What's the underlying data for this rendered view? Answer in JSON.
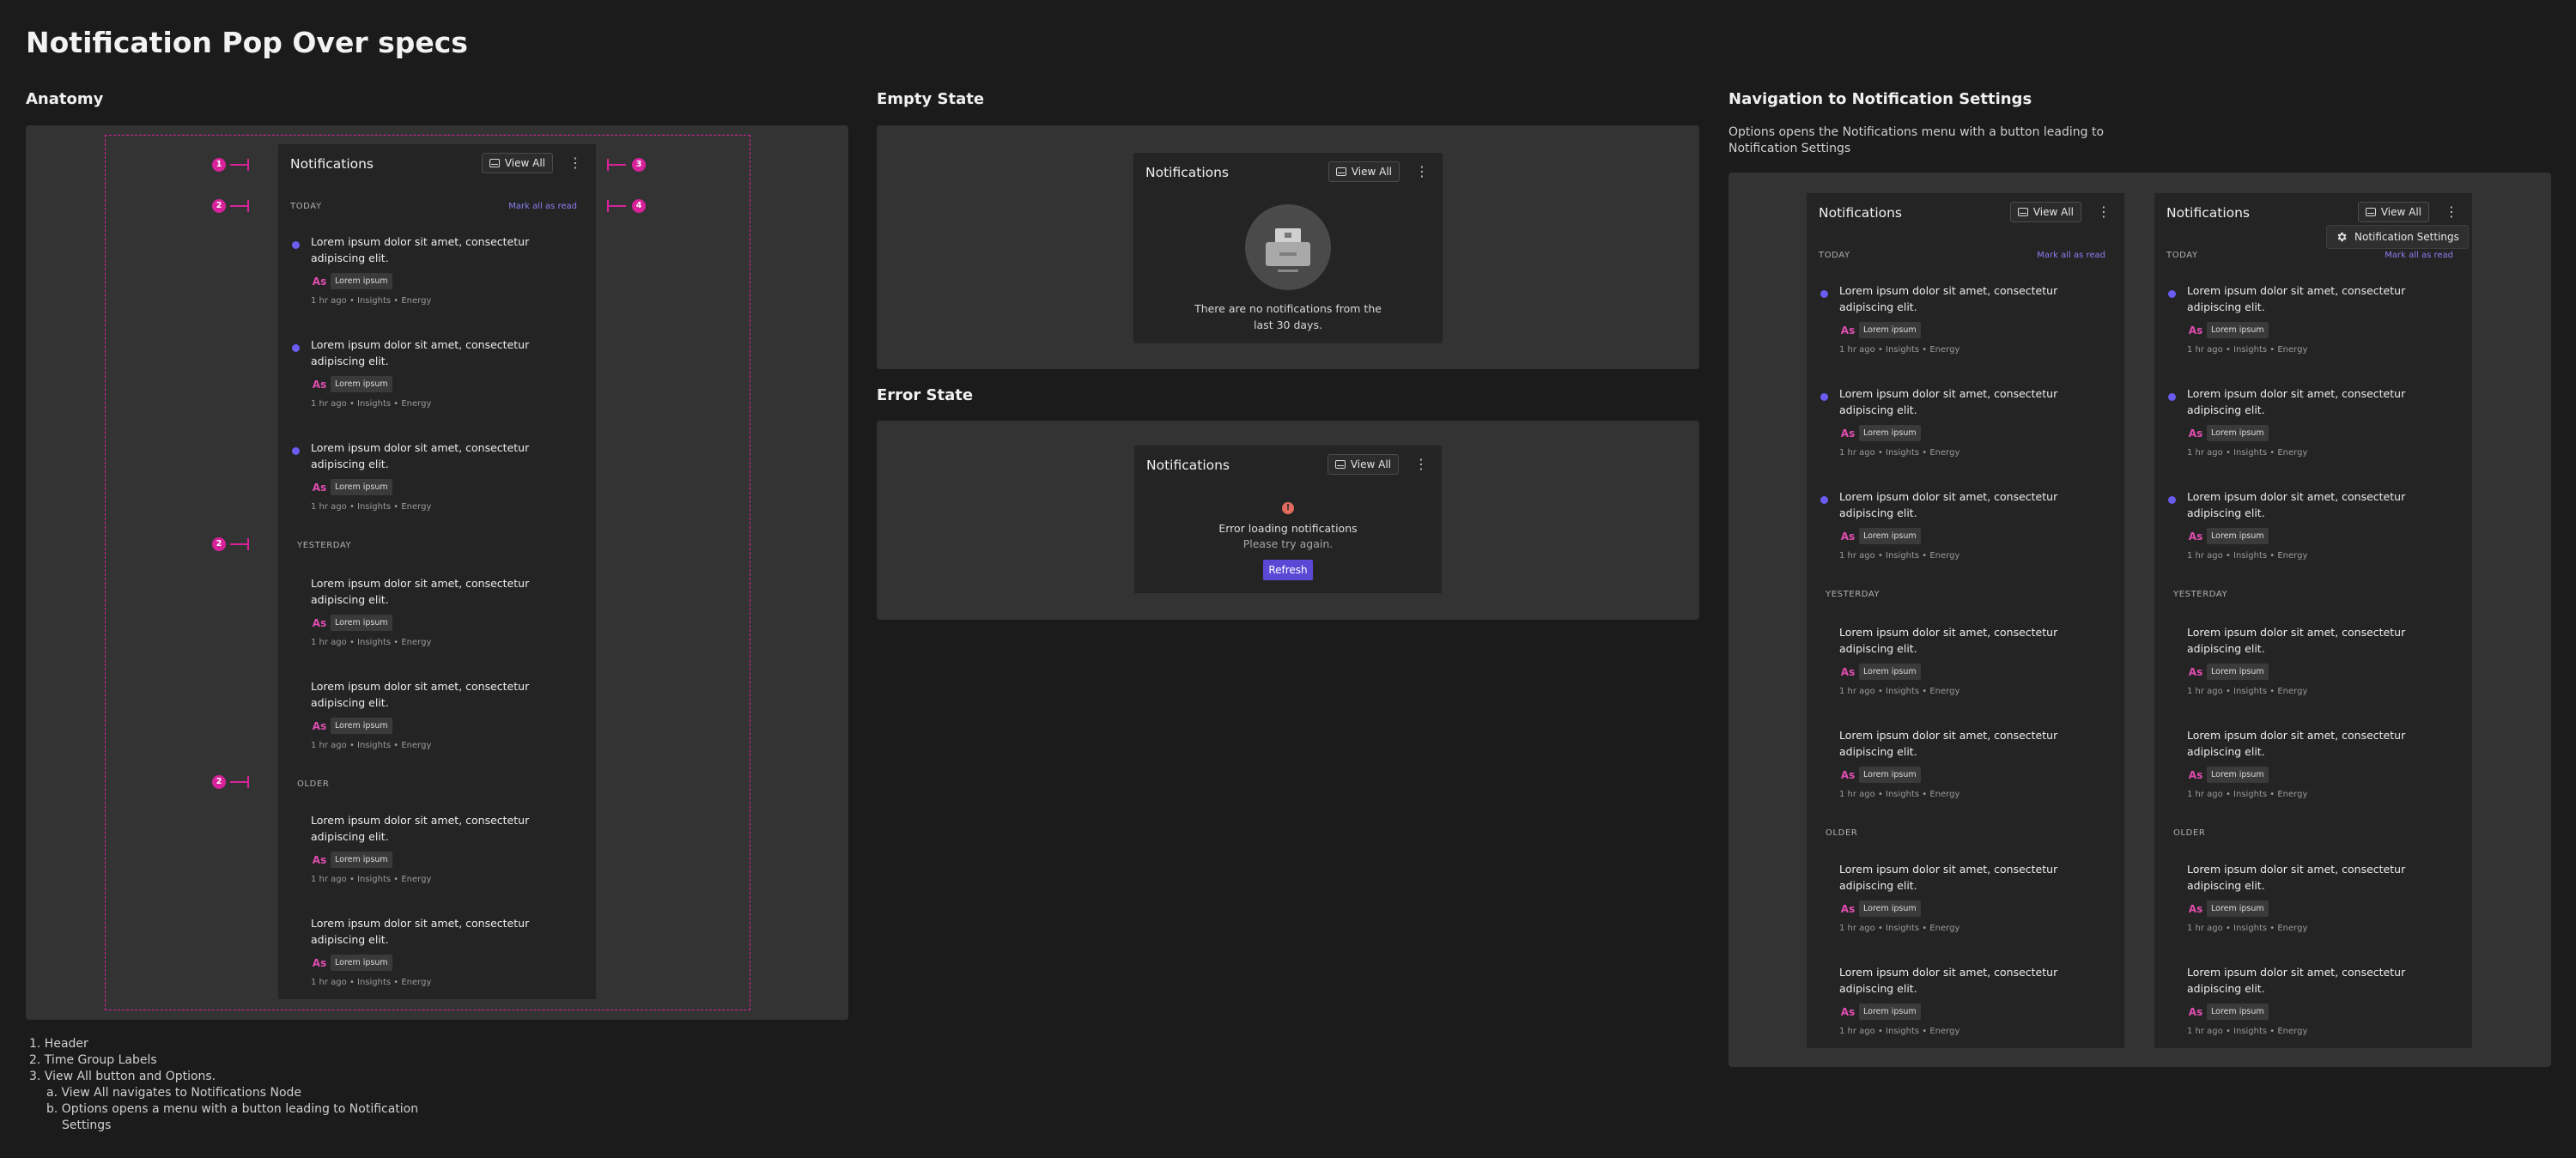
{
  "page_title": "Notification Pop Over specs",
  "sections": {
    "anatomy": "Anatomy",
    "empty": "Empty State",
    "error": "Error State",
    "nav": "Navigation to Notification Settings",
    "nav_desc_1": "Options opens the Notifications menu with a button leading to",
    "nav_desc_2": "Notification Settings"
  },
  "panel": {
    "title": "Notifications",
    "view_all": "View All",
    "kebab": "⋮",
    "mark_all": "Mark all as read",
    "groups": {
      "today": "TODAY",
      "yesterday": "YESTERDAY",
      "older": "OLDER"
    },
    "item_text_1": "Lorem ipsum dolor sit amet, consectetur",
    "item_text_2": "adipiscing elit.",
    "avatar": "As",
    "chip": "Lorem ipsum",
    "meta": "1 hr ago • Insights • Energy"
  },
  "empty": {
    "line1": "There are no notifications from the",
    "line2": "last 30 days."
  },
  "error": {
    "line1": "Error loading notifications",
    "line2": "Please try again.",
    "refresh": "Refresh"
  },
  "settings_menu": {
    "label": "Notification Settings"
  },
  "badges": {
    "one": "1",
    "two": "2",
    "three": "3",
    "four": "4"
  },
  "notes": {
    "n1": "1. Header",
    "n2": "2. Time Group Labels",
    "n3": "3. View All button and Options.",
    "n3a": "a. View All navigates to Notifications Node",
    "n3b1": "b. Options opens a menu with a button leading to Notification",
    "n3b2": "Settings"
  },
  "colors": {
    "accent": "#6b5cf0",
    "annotation": "#d8229a",
    "avatar": "#e04db0",
    "error": "#e26b5e"
  }
}
